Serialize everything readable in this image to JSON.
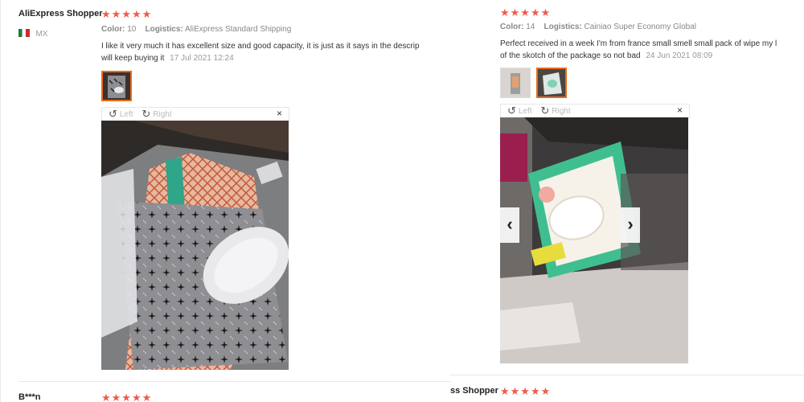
{
  "reviews": {
    "left": {
      "author": "AliExpress Shopper",
      "stars": "★★★★★",
      "country": "MX",
      "color_label": "Color:",
      "color_value": "10",
      "logistics_label": "Logistics:",
      "logistics_value": "AliExpress Standard Shipping",
      "text_line1": "I like it very much it has excellent size and good capacity, it is just as it says in the descrip",
      "text_line2": "will keep buying it",
      "date": "17 Jul 2021 12:24",
      "toolbar": {
        "left": "Left",
        "right": "Right",
        "close": "×"
      }
    },
    "right": {
      "stars": "★★★★★",
      "color_label": "Color:",
      "color_value": "14",
      "logistics_label": "Logistics:",
      "logistics_value": "Cainiao Super Economy Global",
      "text_line1": "Perfect received in a week I'm from france small smell small pack of wipe my l",
      "text_line2": "of the skotch of the package so not bad",
      "date": "24 Jun 2021 08:09",
      "toolbar": {
        "left": "Left",
        "right": "Right",
        "close": "×"
      },
      "prev_icon": "‹",
      "next_icon": "›"
    },
    "next_left": {
      "author": "B***n",
      "stars": "★★★★★"
    },
    "next_right": {
      "author_partial": "ss Shopper",
      "stars": "★★★★★"
    }
  },
  "icons": {
    "rotate_left": "↺",
    "rotate_right": "↻"
  },
  "colors": {
    "star": "#ef5b4e",
    "thumb_active_border": "#e86c1a"
  }
}
